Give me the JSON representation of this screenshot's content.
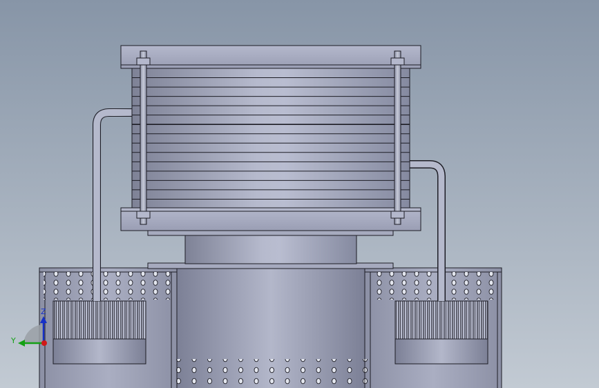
{
  "colors": {
    "background_top": "#8795a7",
    "background_bottom": "#c2cad3",
    "metal_light": "#b9bdd0",
    "metal_mid": "#a3a7bd",
    "metal_dark": "#83879c",
    "outline": "#1c1c24",
    "axis_x": "#d01818",
    "axis_y": "#14a014",
    "axis_z": "#1630c8",
    "triad_disc": "#9aa0a6"
  },
  "triad": {
    "z_label": "Z",
    "y_label": "Y"
  },
  "model": {
    "stack_plate_count": 14,
    "icon": "cad-3d-model-icon"
  }
}
